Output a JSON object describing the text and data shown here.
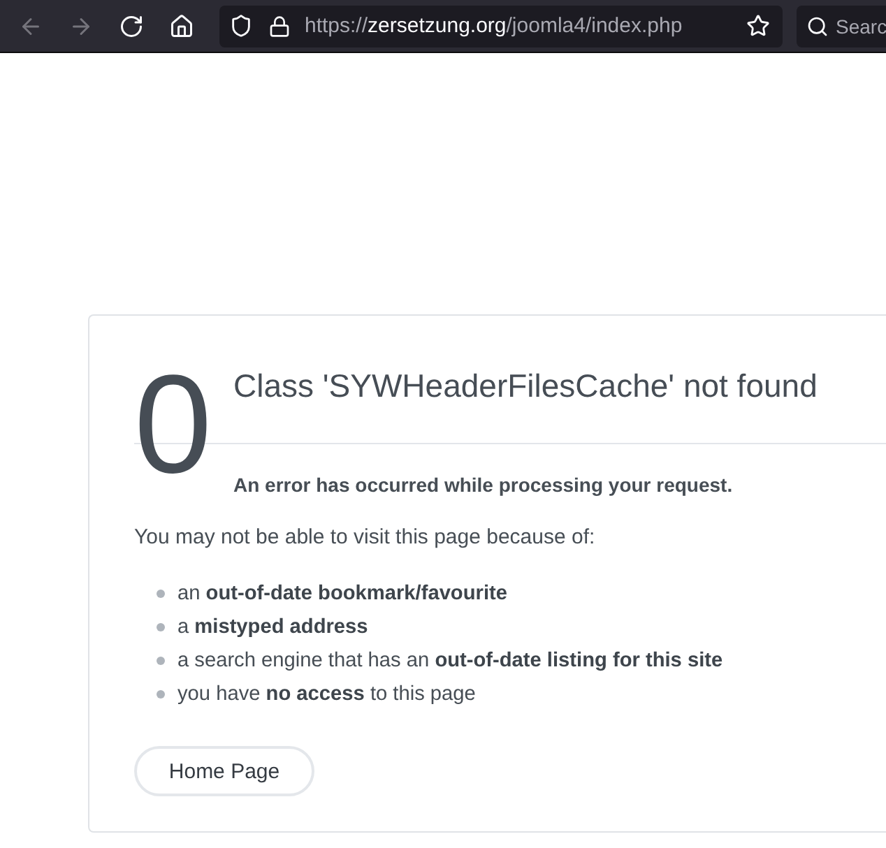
{
  "browser": {
    "nav_buttons": [
      {
        "kind": "back",
        "disabled": true
      },
      {
        "kind": "forward",
        "disabled": true
      },
      {
        "kind": "reload",
        "disabled": false
      },
      {
        "kind": "home",
        "disabled": false
      }
    ],
    "address_bar": {
      "scheme": "https://",
      "host": "zersetzung.org",
      "path": "/joomla4/index.php"
    },
    "search": {
      "placeholder": "Searc"
    }
  },
  "error_card": {
    "code": "0",
    "title": "Class 'SYWHeaderFilesCache' not found",
    "subtitle": "An error has occurred while processing your request.",
    "intro": "You may not be able to visit this page because of:",
    "reasons": [
      "an **out-of-date bookmark/favourite**",
      "a **mistyped address**",
      "a search engine that has an **out-of-date listing for this site**",
      "you have **no access** to this page"
    ],
    "button": "Home Page"
  }
}
